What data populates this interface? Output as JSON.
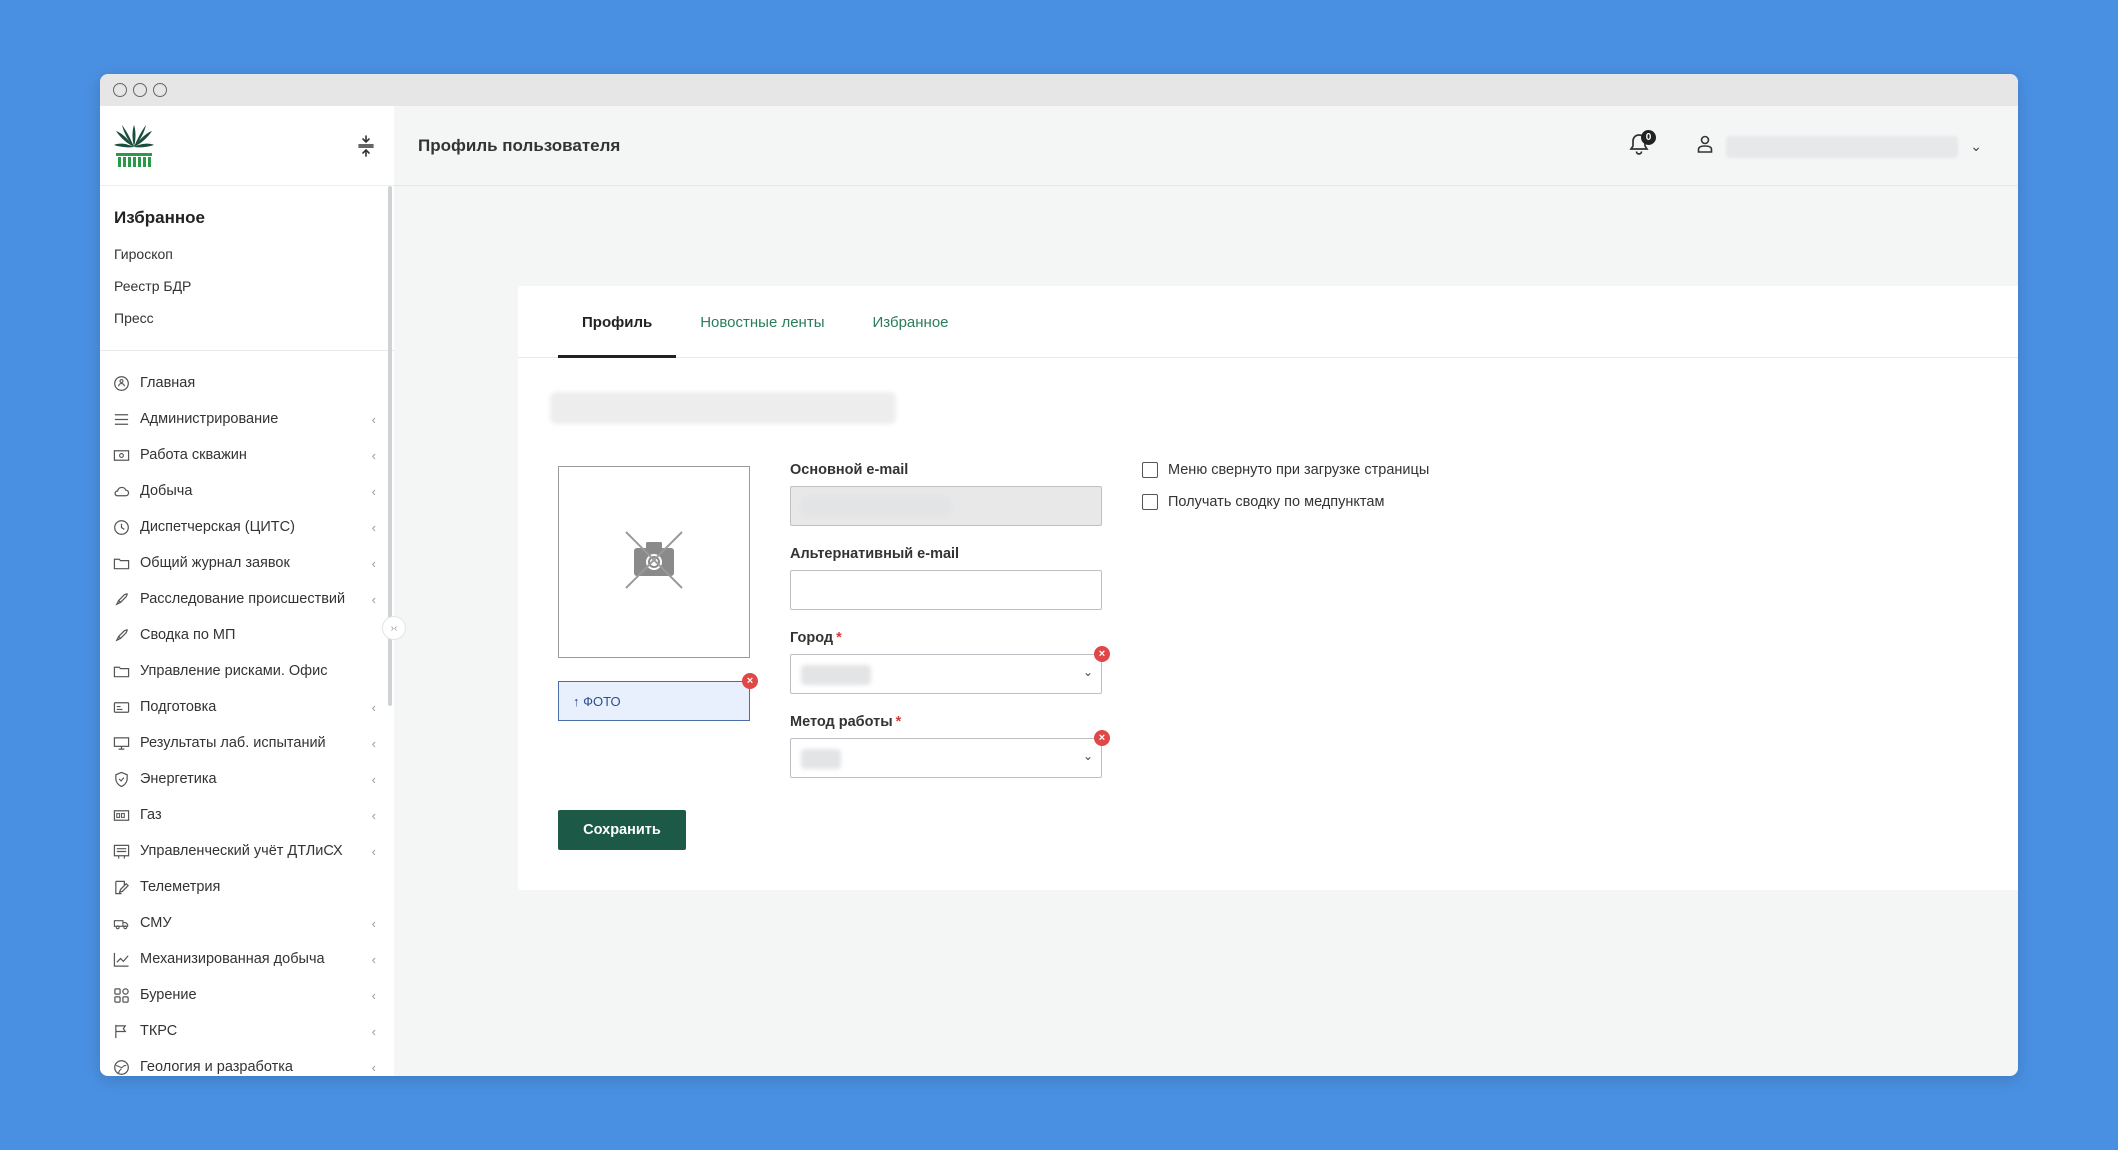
{
  "header": {
    "page_title": "Профиль пользователя",
    "notifications_count": "0",
    "user_name": ""
  },
  "sidebar": {
    "favorites_title": "Избранное",
    "favorites": [
      {
        "label": "Гироскоп"
      },
      {
        "label": "Реестр БДР"
      },
      {
        "label": "Пресс"
      }
    ],
    "items": [
      {
        "label": "Главная",
        "icon": "home-icon",
        "has_children": false
      },
      {
        "label": "Администрирование",
        "icon": "list-icon",
        "has_children": true
      },
      {
        "label": "Работа скважин",
        "icon": "money-icon",
        "has_children": true
      },
      {
        "label": "Добыча",
        "icon": "cloud-icon",
        "has_children": true
      },
      {
        "label": "Диспетчерская (ЦИТС)",
        "icon": "clock-icon",
        "has_children": true
      },
      {
        "label": "Общий журнал заявок",
        "icon": "folder-icon",
        "has_children": true
      },
      {
        "label": "Расследование происшествий",
        "icon": "rocket-icon",
        "has_children": true
      },
      {
        "label": "Сводка по МП",
        "icon": "rocket-icon",
        "has_children": false
      },
      {
        "label": "Управление рисками. Офис",
        "icon": "folder-icon",
        "has_children": false
      },
      {
        "label": "Подготовка",
        "icon": "card-icon",
        "has_children": true
      },
      {
        "label": "Результаты лаб. испытаний",
        "icon": "monitor-icon",
        "has_children": true
      },
      {
        "label": "Энергетика",
        "icon": "shield-icon",
        "has_children": true
      },
      {
        "label": "Газ",
        "icon": "gauge-icon",
        "has_children": true
      },
      {
        "label": "Управленческий учёт ДТЛиСХ",
        "icon": "report-icon",
        "has_children": true
      },
      {
        "label": "Телеметрия",
        "icon": "edit-icon",
        "has_children": false
      },
      {
        "label": "СМУ",
        "icon": "truck-icon",
        "has_children": true
      },
      {
        "label": "Механизированная добыча",
        "icon": "chart-line-icon",
        "has_children": true
      },
      {
        "label": "Бурение",
        "icon": "grid-icon",
        "has_children": true
      },
      {
        "label": "ТКРС",
        "icon": "flag-icon",
        "has_children": true
      },
      {
        "label": "Геология и разработка",
        "icon": "globe-icon",
        "has_children": true
      }
    ]
  },
  "profile": {
    "tabs": [
      {
        "label": "Профиль",
        "active": true
      },
      {
        "label": "Новостные ленты",
        "active": false
      },
      {
        "label": "Избранное",
        "active": false
      }
    ],
    "photo_button": "↑ ФОТО",
    "primary_email_label": "Основной e-mail",
    "primary_email_value": "",
    "alt_email_label": "Альтернативный e-mail",
    "alt_email_value": "",
    "city_label": "Город",
    "city_value": "",
    "method_label": "Метод работы",
    "method_value": "",
    "required_mark": "*",
    "checkbox_menu_collapsed": "Меню свернуто при загрузке страницы",
    "checkbox_medpoints": "Получать сводку по медпунктам",
    "save_button": "Сохранить"
  },
  "colors": {
    "background": "#4a90e2",
    "accent_green": "#1c5a47",
    "tab_link": "#2a7d5b",
    "error_red": "#e04848"
  }
}
